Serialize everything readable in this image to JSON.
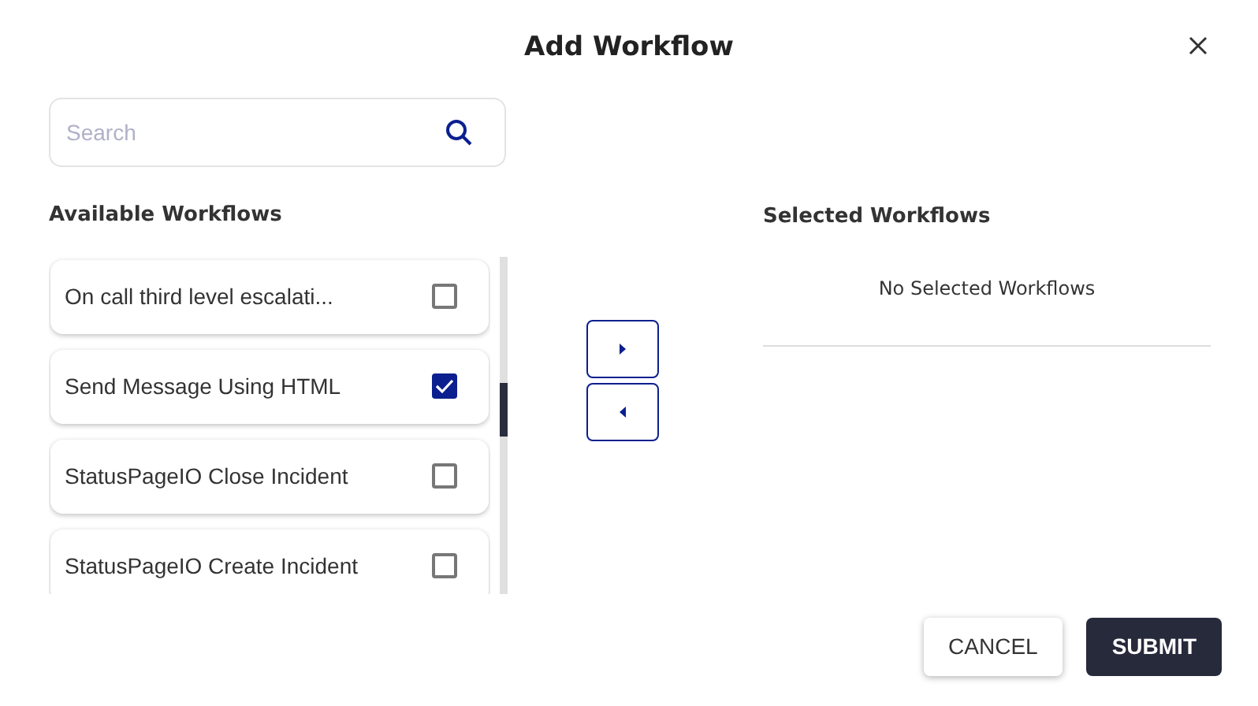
{
  "dialog": {
    "title": "Add Workflow"
  },
  "search": {
    "placeholder": "Search"
  },
  "available": {
    "heading": "Available Workflows",
    "items": [
      {
        "label": "On call third level escalati...",
        "checked": false
      },
      {
        "label": "Send Message Using HTML",
        "checked": true
      },
      {
        "label": "StatusPageIO Close Incident",
        "checked": false
      },
      {
        "label": "StatusPageIO Create Incident",
        "checked": false
      }
    ]
  },
  "selected": {
    "heading": "Selected Workflows",
    "empty_text": "No Selected Workflows"
  },
  "buttons": [
    {
      "label": "CANCEL",
      "kind": "secondary"
    },
    {
      "label": "SUBMIT",
      "kind": "primary"
    }
  ]
}
